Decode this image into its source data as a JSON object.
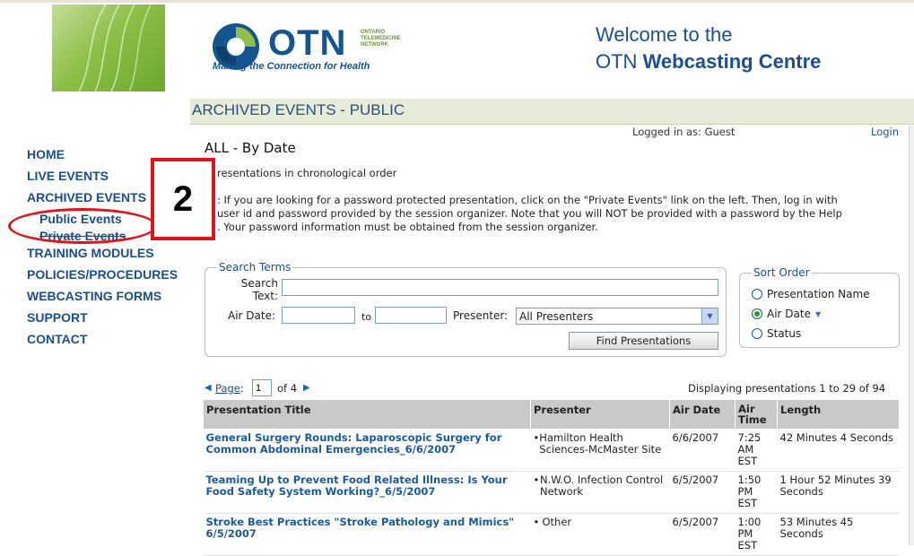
{
  "header": {
    "otn_word": "OTN",
    "otn_org_lines": [
      "ONTARIO",
      "TELEMEDICINE",
      "NETWORK"
    ],
    "tagline": "Making the Connection for Health",
    "welcome_line1": "Welcome to the",
    "welcome_line2_prefix": "OTN ",
    "welcome_line2_bold": "Webcasting Centre"
  },
  "band": {
    "title": "ARCHIVED EVENTS - PUBLIC"
  },
  "nav": {
    "items": [
      {
        "label": "HOME"
      },
      {
        "label": "LIVE EVENTS"
      },
      {
        "label": "ARCHIVED EVENTS"
      },
      {
        "label": "Public Events"
      },
      {
        "label": "Private Events"
      },
      {
        "label": "TRAINING MODULES"
      },
      {
        "label": "POLICIES/PROCEDURES"
      },
      {
        "label": "WEBCASTING FORMS"
      },
      {
        "label": "SUPPORT"
      },
      {
        "label": "CONTACT"
      }
    ]
  },
  "callout": {
    "number": "2"
  },
  "session": {
    "logged_in": "Logged in as: Guest",
    "login_link": "Login"
  },
  "page": {
    "heading": "ALL - By Date",
    "intro": "resentations in chronological order",
    "note_lines": [
      ": If you are looking for a password protected presentation, click on the \"Private Events\" link on the left. Then, log in with",
      "user id and password provided by the session organizer. Note that you will NOT be provided with a password by the Help",
      ". Your password information must be obtained from the session organizer."
    ]
  },
  "search": {
    "legend": "Search Terms",
    "search_label_1": "Search",
    "search_label_2": "Text:",
    "search_value": "",
    "air_date_label": "Air Date:",
    "air_date_from": "",
    "to_label": "to",
    "air_date_to": "",
    "presenter_label": "Presenter:",
    "presenter_value": "All Presenters",
    "find_button": "Find Presentations"
  },
  "sort": {
    "legend": "Sort Order",
    "options": [
      {
        "label": "Presentation Name",
        "selected": false
      },
      {
        "label": "Air Date",
        "selected": true
      },
      {
        "label": "Status",
        "selected": false
      }
    ]
  },
  "pager": {
    "page_label": "Page",
    "colon": ":",
    "current_page": "1",
    "of_label": "of 4",
    "displaying": "Displaying presentations 1 to 29 of 94"
  },
  "table": {
    "columns": [
      "Presentation Title",
      "Presenter",
      "Air Date",
      "Air Time",
      "Length"
    ],
    "rows": [
      {
        "title": "General Surgery Rounds: Laparoscopic Surgery for Common Abdominal Emergencies_6/6/2007",
        "presenter": "Hamilton Health Sciences-McMaster Site",
        "air_date": "6/6/2007",
        "air_time": "7:25 AM EST",
        "length": "42 Minutes 4 Seconds"
      },
      {
        "title": "Teaming Up to Prevent Food Related Illness: Is Your Food Safety System Working?_6/5/2007",
        "presenter": "N.W.O. Infection Control Network",
        "air_date": "6/5/2007",
        "air_time": "1:50 PM EST",
        "length": "1 Hour 52 Minutes 39 Seconds"
      },
      {
        "title": "Stroke Best Practices \"Stroke Pathology and Mimics\"  6/5/2007",
        "presenter": "Other",
        "air_date": "6/5/2007",
        "air_time": "1:00 PM EST",
        "length": "53 Minutes 45 Seconds"
      }
    ]
  },
  "colors": {
    "brand_blue": "#14558f",
    "link_blue": "#1c4d8c",
    "annotation_red": "#e0141a",
    "header_green": "#8ebf48"
  }
}
